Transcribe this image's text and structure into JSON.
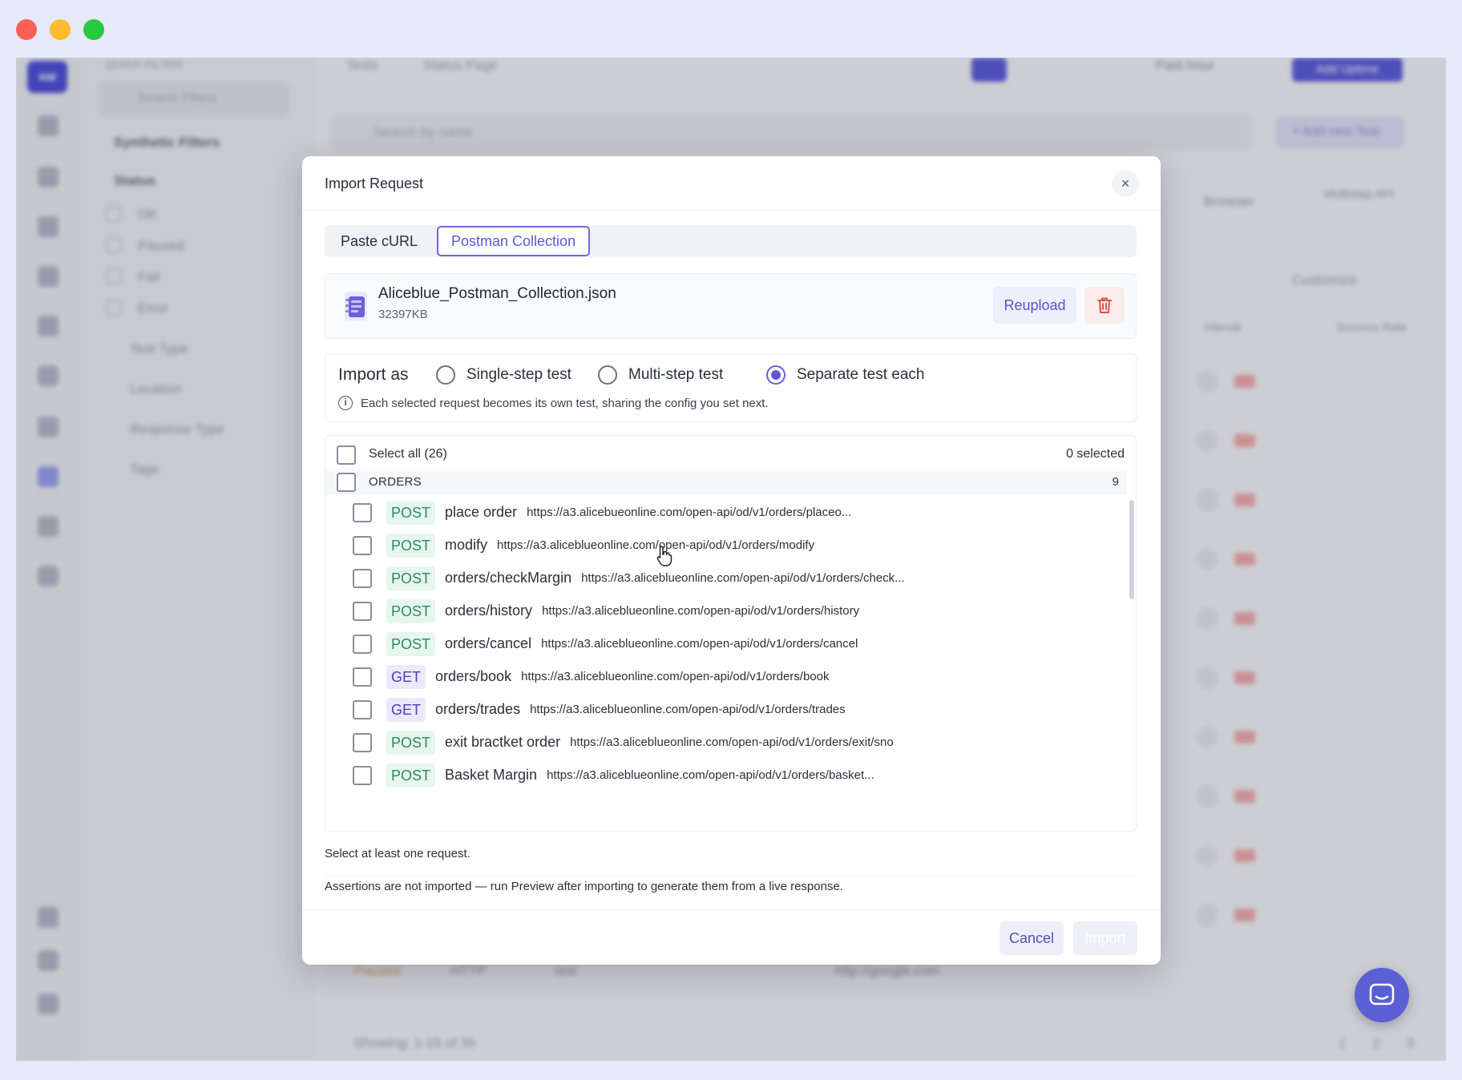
{
  "window": {
    "controls": [
      "close",
      "minimize",
      "maximize"
    ]
  },
  "background": {
    "logo_text": "AW",
    "filters_title": "QUICK FILTER",
    "filters_search_placeholder": "Search Filters",
    "filters_group": "Synthetic Filters",
    "status_label": "Status",
    "status_options": [
      "OK",
      "Paused",
      "Fail",
      "Error"
    ],
    "sections": [
      "Test Type",
      "Location",
      "Response Type",
      "Tags"
    ],
    "tabs": [
      "Tests",
      "Status Page"
    ],
    "search_placeholder": "Search by name",
    "add_test_label": "+ Add new Test",
    "time_range": "Past hour",
    "add_uptime_label": "Add Uptime",
    "counts": [
      "Browser",
      "Multistep API"
    ],
    "customize_label": "Customize",
    "columns": [
      "Interval",
      "Success Rate"
    ],
    "row_status": "Paused",
    "row_type": "HTTP",
    "row_name": "test",
    "row_url": "http://google.com",
    "showing": "Showing: 1-15 of 35",
    "pages": [
      "1",
      "2",
      "3"
    ]
  },
  "modal": {
    "title": "Import Request",
    "close_label": "×",
    "tabs": [
      {
        "label": "Paste cURL",
        "active": false
      },
      {
        "label": "Postman Collection",
        "active": true
      }
    ],
    "file": {
      "icon": "postman-file-icon",
      "name": "Aliceblue_Postman_Collection.json",
      "size": "32397KB",
      "reupload_label": "Reupload",
      "delete_icon": "trash-icon"
    },
    "import_as": {
      "label": "Import as",
      "options": [
        {
          "label": "Single-step test",
          "selected": false
        },
        {
          "label": "Multi-step test",
          "selected": false
        },
        {
          "label": "Separate test each",
          "selected": true
        }
      ],
      "info": "Each selected request becomes its own test, sharing the config you set next."
    },
    "list": {
      "select_all_label": "Select all (26)",
      "selected_count": "0 selected",
      "group": {
        "name": "ORDERS",
        "count": "9"
      },
      "requests": [
        {
          "method": "POST",
          "name": "place order",
          "url": "https://a3.alicebueonline.com/open-api/od/v1/orders/placeo..."
        },
        {
          "method": "POST",
          "name": "modify",
          "url": "https://a3.aliceblueonline.com/open-api/od/v1/orders/modify"
        },
        {
          "method": "POST",
          "name": "orders/checkMargin",
          "url": "https://a3.aliceblueonline.com/open-api/od/v1/orders/check..."
        },
        {
          "method": "POST",
          "name": "orders/history",
          "url": "https://a3.aliceblueonline.com/open-api/od/v1/orders/history"
        },
        {
          "method": "POST",
          "name": "orders/cancel",
          "url": "https://a3.aliceblueonline.com/open-api/od/v1/orders/cancel"
        },
        {
          "method": "GET",
          "name": "orders/book",
          "url": "https://a3.aliceblueonline.com/open-api/od/v1/orders/book"
        },
        {
          "method": "GET",
          "name": "orders/trades",
          "url": "https://a3.aliceblueonline.com/open-api/od/v1/orders/trades"
        },
        {
          "method": "POST",
          "name": "exit bractket order",
          "url": "https://a3.aliceblueonline.com/open-api/od/v1/orders/exit/sno"
        },
        {
          "method": "POST",
          "name": "Basket Margin",
          "url": "https://a3.aliceblueonline.com/open-api/od/v1/orders/basket..."
        }
      ]
    },
    "hint": "Select at least one request.",
    "assertions_note": "Assertions are not imported — run Preview after importing to generate them from a live response.",
    "cancel_label": "Cancel",
    "import_label": "Import"
  },
  "colors": {
    "accent": "#5a5ad2",
    "post_method": "#2d8a5c",
    "get_method": "#4a42b8",
    "danger": "#e05252"
  }
}
